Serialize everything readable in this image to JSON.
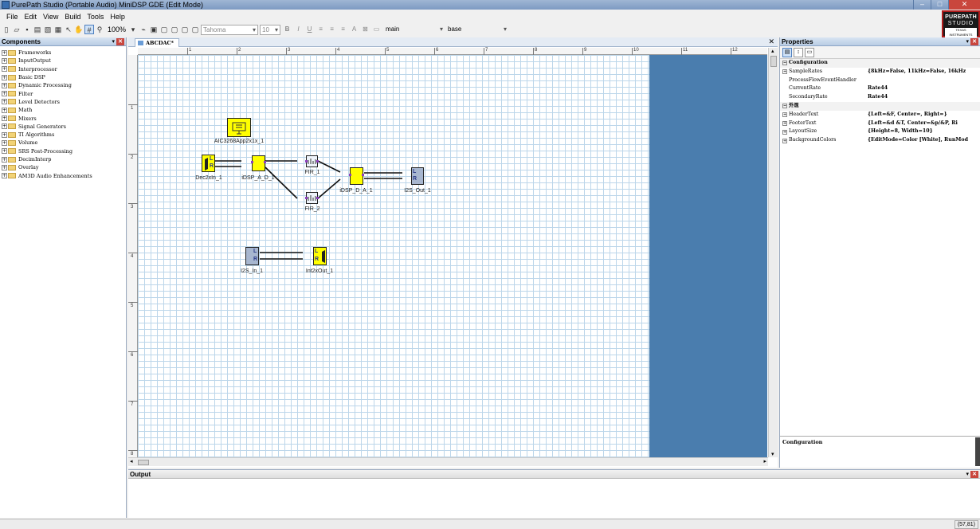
{
  "window": {
    "title": "PurePath Studio (Portable Audio) MiniDSP GDE (Edit Mode)",
    "controls": [
      "–",
      "□",
      "✕"
    ]
  },
  "menu": [
    "File",
    "Edit",
    "View",
    "Build",
    "Tools",
    "Help"
  ],
  "logo": {
    "line1": "PUREPATH",
    "line2": "STUDIO",
    "line3": "TEXAS INSTRUMENTS"
  },
  "toolbar": {
    "zoom": "100%",
    "font": "Tahoma",
    "font_size": "10",
    "format_buttons": [
      "B",
      "I",
      "U"
    ],
    "context_select": "main",
    "base_select": "base"
  },
  "components": {
    "title": "Components",
    "items": [
      "Frameworks",
      "InputOutput",
      "Interprocessor",
      "Basic DSP",
      "Dynamic Processing",
      "Filter",
      "Level Detectors",
      "Math",
      "Mixers",
      "Signal Generators",
      "TI Algorithms",
      "Volume",
      "SRS Post-Processing",
      "DecimInterp",
      "Overlay",
      "AM3D Audio Enhancements"
    ]
  },
  "document": {
    "tab": "ABCDAC*",
    "ruler_h": [
      "1",
      "2",
      "3",
      "4",
      "5",
      "6",
      "7",
      "8",
      "9",
      "10",
      "11",
      "12"
    ],
    "ruler_v": [
      "1",
      "2",
      "3",
      "4",
      "5",
      "6",
      "7",
      "8"
    ],
    "blocks": {
      "aic": "AIC3268App2x1x_1",
      "dec": "Dec2xIn_1",
      "idsp_ad": "iDSP_A_D_1",
      "fir1": "FIR_1",
      "fir2": "FIR_2",
      "idsp_da": "iDSP_D_A_1",
      "i2s_out": "I2S_Out_1",
      "i2s_in": "I2S_In_1",
      "int": "Int2xOut_1"
    },
    "port_l": "L",
    "port_r": "R"
  },
  "properties": {
    "title": "Properties",
    "rows": [
      {
        "cat": true,
        "name": "Configuration",
        "value": ""
      },
      {
        "exp": true,
        "name": "SampleRates",
        "value": "{8kHz=False, 11kHz=False, 16kHz"
      },
      {
        "name": "ProcessFlowEventHandler",
        "value": ""
      },
      {
        "name": "CurrentRate",
        "value": "Rate44"
      },
      {
        "name": "SecondaryRate",
        "value": "Rate44"
      },
      {
        "cat": true,
        "name": "外观",
        "value": ""
      },
      {
        "exp": true,
        "name": "HeaderText",
        "value": "{Left=&F, Center=, Right=}"
      },
      {
        "exp": true,
        "name": "FooterText",
        "value": "{Left=&d  &T, Center=&p/&P, Ri"
      },
      {
        "exp": true,
        "name": "LayoutSize",
        "value": "{Height=8, Width=10}"
      },
      {
        "exp": true,
        "name": "BackgroundColors",
        "value": "{EditMode=Color [White], RunMod"
      }
    ],
    "description": "Configuration"
  },
  "output": {
    "title": "Output"
  },
  "status": {
    "coords": "(57,81)"
  }
}
